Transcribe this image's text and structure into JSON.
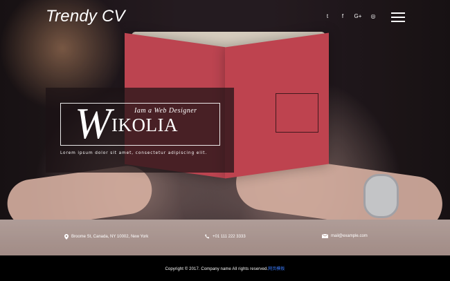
{
  "brand": {
    "name": "Trendy CV"
  },
  "social": [
    {
      "name": "twitter",
      "icon": "twitter-icon",
      "glyph": "t"
    },
    {
      "name": "facebook",
      "icon": "facebook-icon",
      "glyph": "f"
    },
    {
      "name": "google-plus",
      "icon": "google-plus-icon",
      "glyph": "G+"
    },
    {
      "name": "dribbble",
      "icon": "dribbble-icon",
      "glyph": "◎"
    }
  ],
  "menu": {
    "icon": "hamburger-menu-icon"
  },
  "intro": {
    "tagline": "Iam a Web Designer",
    "name_initial": "W",
    "name_rest": "IKOLIA",
    "description": "Lorem ipsum dolor sit amet, consectetur adipiscing elit."
  },
  "contacts": [
    {
      "icon": "location-pin-icon",
      "text": "Broome St, Canada, NY 10002, New York"
    },
    {
      "icon": "phone-icon",
      "text": "+01 111 222 3333"
    },
    {
      "icon": "envelope-icon",
      "text": "mail@example.com"
    }
  ],
  "footer": {
    "copyright_text": "Copyright © 2017. Company name All rights reserved.",
    "link_text": "网页模板"
  },
  "colors": {
    "footer_background": "#000000",
    "footer_link": "#3b7cff",
    "overlay_panel": "#1c1215"
  }
}
